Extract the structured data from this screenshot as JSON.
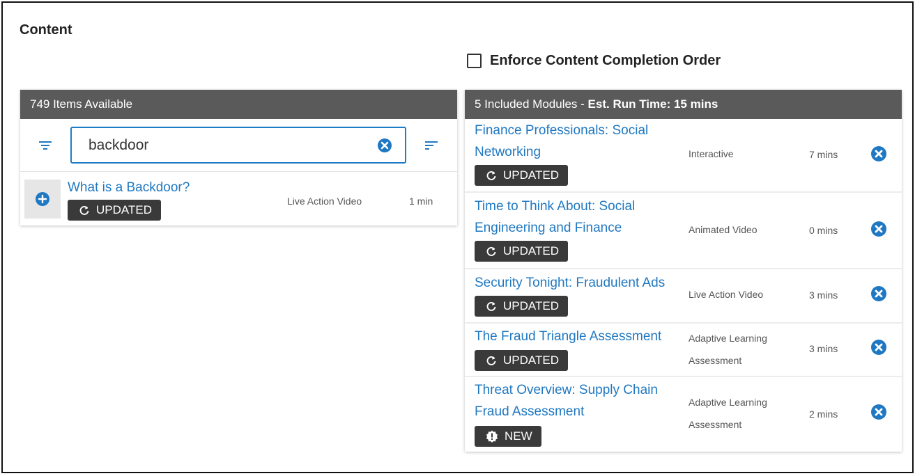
{
  "section_title": "Content",
  "enforce_label": "Enforce Content Completion Order",
  "left_panel": {
    "header": "749 Items Available",
    "search_value": "backdoor",
    "results": [
      {
        "title": "What is a Backdoor?",
        "badge": "UPDATED",
        "badge_icon": "refresh-icon",
        "type": "Live Action Video",
        "duration": "1 min"
      }
    ]
  },
  "right_panel": {
    "header_prefix": "5 Included Modules - ",
    "header_bold": "Est. Run Time: 15 mins",
    "modules": [
      {
        "title_line1": "Finance Professionals: Social",
        "title_line2": "Networking",
        "badge": "UPDATED",
        "badge_icon": "refresh-icon",
        "type_line1": "Interactive",
        "type_line2": "",
        "duration": "7 mins"
      },
      {
        "title_line1": "Time to Think About: Social",
        "title_line2": "Engineering and Finance",
        "badge": "UPDATED",
        "badge_icon": "refresh-icon",
        "type_line1": "Animated Video",
        "type_line2": "",
        "duration": "0 mins"
      },
      {
        "title_line1": "Security Tonight: Fraudulent Ads",
        "title_line2": "",
        "badge": "UPDATED",
        "badge_icon": "refresh-icon",
        "type_line1": "Live Action Video",
        "type_line2": "",
        "duration": "3 mins"
      },
      {
        "title_line1": "The Fraud Triangle Assessment",
        "title_line2": "",
        "badge": "UPDATED",
        "badge_icon": "refresh-icon",
        "type_line1": "Adaptive Learning",
        "type_line2": "Assessment",
        "duration": "3 mins"
      },
      {
        "title_line1": "Threat Overview: Supply Chain",
        "title_line2": "Fraud Assessment",
        "badge": "NEW",
        "badge_icon": "alert-icon",
        "type_line1": "Adaptive Learning",
        "type_line2": "Assessment",
        "duration": "2 mins"
      }
    ]
  },
  "colors": {
    "accent": "#1f78c1",
    "header_bg": "#5a5a5a",
    "badge_bg": "#3a3a3a"
  }
}
